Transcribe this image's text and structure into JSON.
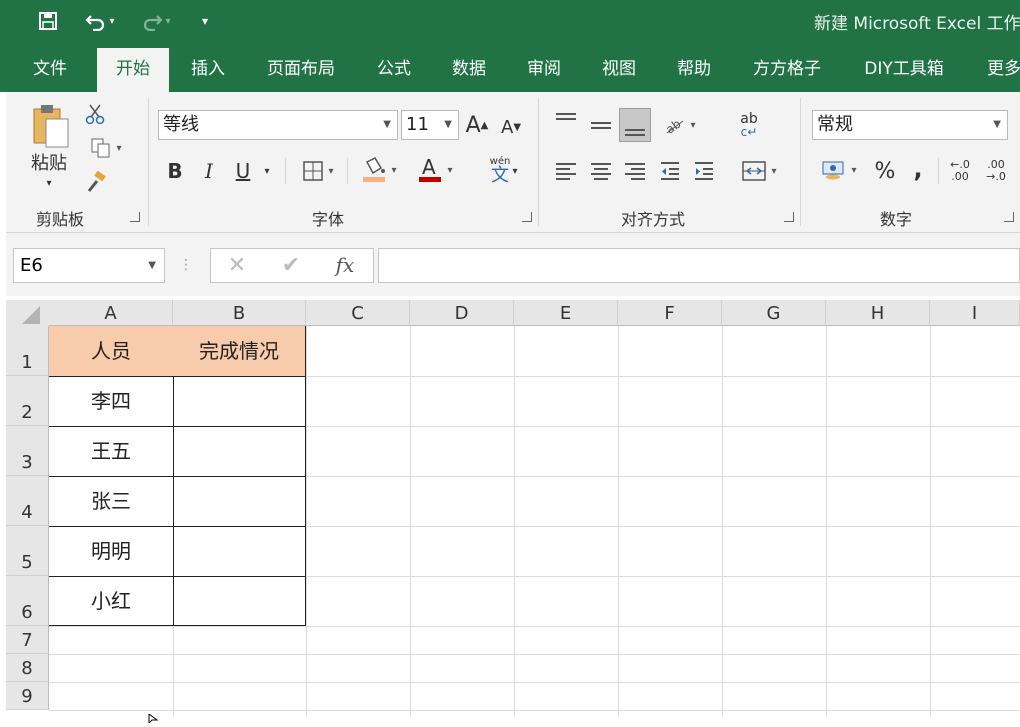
{
  "window": {
    "title": "新建 Microsoft Excel 工作表"
  },
  "quick_access": {
    "save": "save-icon",
    "undo": "undo-icon",
    "redo": "redo-icon",
    "customize": "▾"
  },
  "tabs": [
    "文件",
    "开始",
    "插入",
    "页面布局",
    "公式",
    "数据",
    "审阅",
    "视图",
    "帮助",
    "方方格子",
    "DIY工具箱",
    "更多"
  ],
  "active_tab": "开始",
  "ribbon": {
    "clipboard": {
      "label": "剪贴板",
      "paste": "粘贴"
    },
    "font": {
      "label": "字体",
      "name": "等线",
      "size": "11",
      "grow": "A",
      "shrink": "A",
      "bold": "B",
      "italic": "I",
      "underline": "U",
      "phonetic_top": "wén",
      "phonetic_bottom": "文"
    },
    "alignment": {
      "label": "对齐方式",
      "wrap": "ab"
    },
    "number": {
      "label": "数字",
      "format": "常规",
      "percent": "%",
      "comma": ",",
      "inc_dec": "←.0 .00",
      "dec_dec": ".00 →.0"
    }
  },
  "colors": {
    "brand": "#217346",
    "header_fill": "#f8cbad",
    "font_color": "#c00000",
    "fill_color": "#f4b183"
  },
  "formula_bar": {
    "name_box": "E6",
    "cancel": "✕",
    "enter": "✔",
    "fx": "fx",
    "value": ""
  },
  "columns": [
    "A",
    "B",
    "C",
    "D",
    "E",
    "F",
    "G",
    "H",
    "I"
  ],
  "rows": [
    "1",
    "2",
    "3",
    "4",
    "5",
    "6",
    "7",
    "8",
    "9"
  ],
  "cells": {
    "A1": "人员",
    "B1": "完成情况",
    "A2": "李四",
    "A3": "王五",
    "A4": "张三",
    "A5": "明明",
    "A6": "小红"
  }
}
